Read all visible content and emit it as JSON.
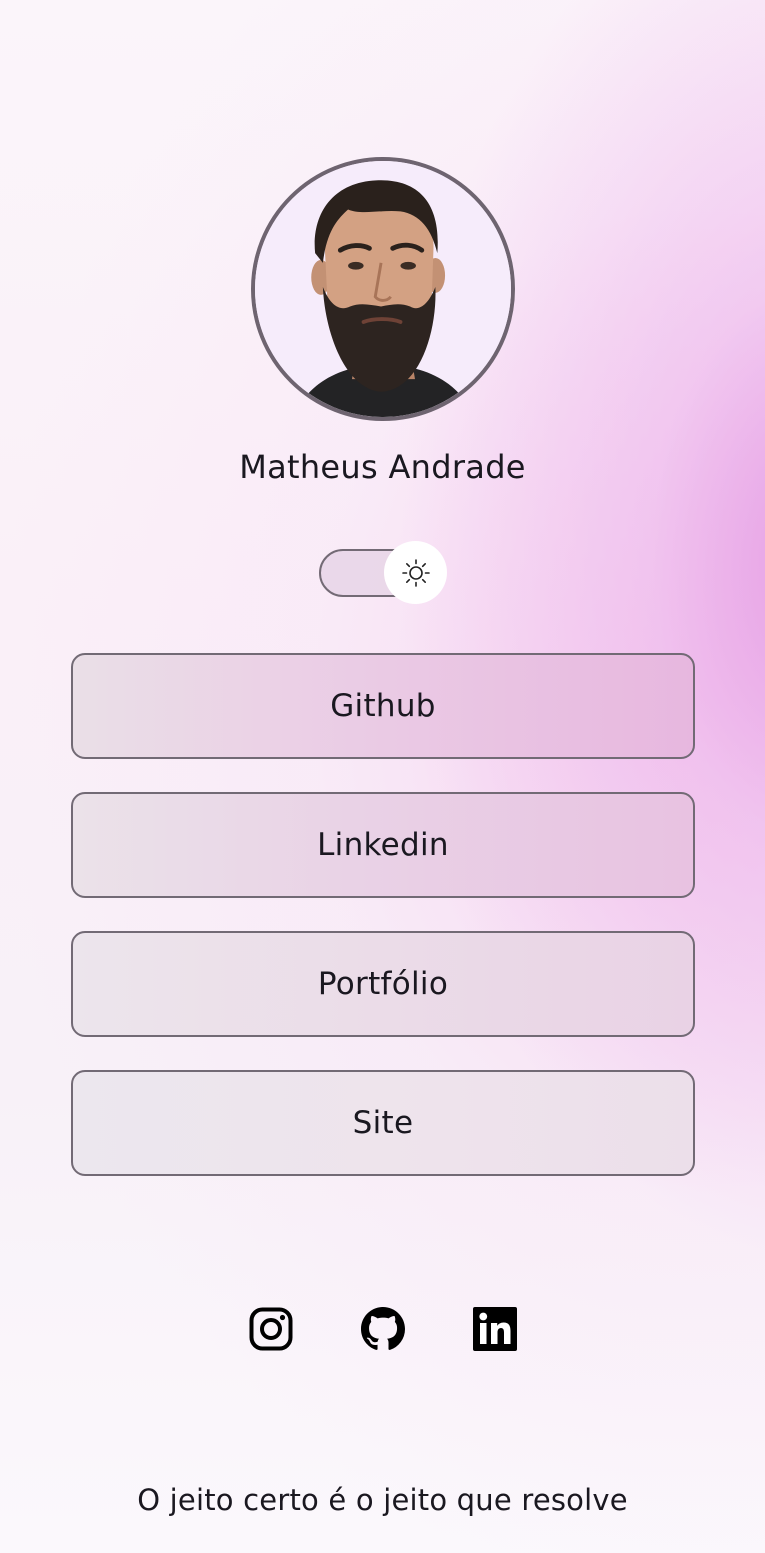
{
  "profile": {
    "name": "Matheus Andrade",
    "avatar_icon": "profile-photo"
  },
  "theme_toggle": {
    "icon": "sun-icon",
    "mode": "light"
  },
  "links": [
    {
      "label": "Github"
    },
    {
      "label": "Linkedin"
    },
    {
      "label": "Portfólio"
    },
    {
      "label": "Site"
    }
  ],
  "social": [
    {
      "icon": "instagram-icon"
    },
    {
      "icon": "github-icon"
    },
    {
      "icon": "linkedin-icon"
    }
  ],
  "footer": {
    "tagline": "O jeito certo é o jeito que resolve"
  },
  "colors": {
    "accent_pink": "#e292e2",
    "border": "#726a75",
    "text": "#1a1820"
  }
}
